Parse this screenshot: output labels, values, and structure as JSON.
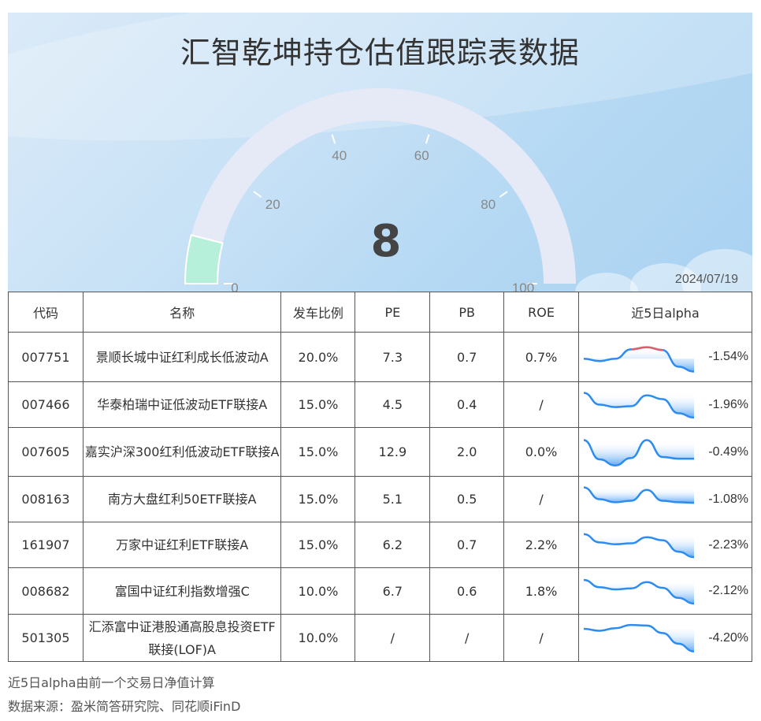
{
  "header": {
    "title": "汇智乾坤持仓估值跟踪表数据",
    "date": "2024/07/19"
  },
  "gauge": {
    "value": 8,
    "value_label": "8",
    "min": 0,
    "max": 100,
    "ticks": [
      "0",
      "20",
      "40",
      "60",
      "80",
      "100"
    ],
    "fill_color": "#b6f0da",
    "track_color": "#e6e9f6"
  },
  "table": {
    "headers": [
      "代码",
      "名称",
      "发车比例",
      "PE",
      "PB",
      "ROE",
      "近5日alpha"
    ],
    "rows": [
      {
        "code": "007751",
        "name": "景顺长城中证红利成长低波动A",
        "ratio": "20.0%",
        "pe": "7.3",
        "pb": "0.7",
        "roe": "0.7%",
        "alpha": "-1.54%",
        "spark": [
          0.55,
          0.62,
          0.55,
          0.28,
          0.22,
          0.3,
          0.78,
          0.92
        ],
        "highlight": [
          3,
          5
        ]
      },
      {
        "code": "007466",
        "name": "华泰柏瑞中证低波动ETF联接A",
        "ratio": "15.0%",
        "pe": "4.5",
        "pb": "0.4",
        "roe": "/",
        "alpha": "-1.96%",
        "spark": [
          0.12,
          0.5,
          0.58,
          0.55,
          0.2,
          0.32,
          0.78,
          0.92
        ],
        "highlight": []
      },
      {
        "code": "007605",
        "name": "嘉实沪深300红利低波动ETF联接A",
        "ratio": "15.0%",
        "pe": "12.9",
        "pb": "2.0",
        "roe": "0.0%",
        "alpha": "-0.49%",
        "spark": [
          0.15,
          0.72,
          0.9,
          0.68,
          0.15,
          0.65,
          0.7,
          0.7
        ],
        "highlight": []
      },
      {
        "code": "008163",
        "name": "南方大盘红利50ETF联接A",
        "ratio": "15.0%",
        "pe": "5.1",
        "pb": "0.5",
        "roe": "/",
        "alpha": "-1.08%",
        "spark": [
          0.12,
          0.5,
          0.6,
          0.55,
          0.2,
          0.55,
          0.6,
          0.62
        ],
        "highlight": []
      },
      {
        "code": "161907",
        "name": "万家中证红利ETF联接A",
        "ratio": "15.0%",
        "pe": "6.2",
        "pb": "0.7",
        "roe": "2.2%",
        "alpha": "-2.23%",
        "spark": [
          0.15,
          0.42,
          0.48,
          0.45,
          0.25,
          0.35,
          0.72,
          0.9
        ],
        "highlight": []
      },
      {
        "code": "008682",
        "name": "富国中证红利指数增强C",
        "ratio": "10.0%",
        "pe": "6.7",
        "pb": "0.6",
        "roe": "1.8%",
        "alpha": "-2.12%",
        "spark": [
          0.15,
          0.38,
          0.45,
          0.42,
          0.22,
          0.4,
          0.72,
          0.9
        ],
        "highlight": []
      },
      {
        "code": "501305",
        "name": "汇添富中证港股通高股息投资ETF联接(LOF)A",
        "ratio": "10.0%",
        "pe": "/",
        "pb": "/",
        "roe": "/",
        "alpha": "-4.20%",
        "spark": [
          0.22,
          0.28,
          0.2,
          0.1,
          0.12,
          0.35,
          0.68,
          0.92
        ],
        "highlight": []
      }
    ]
  },
  "footnotes": {
    "note": "近5日alpha由前一个交易日净值计算",
    "source": "数据来源：盈米简答研究院、同花顺iFinD"
  },
  "colors": {
    "spark_line": "#2d8cf0",
    "spark_fill_top": "#4a9cf2",
    "spark_highlight": "#e05c6a"
  }
}
